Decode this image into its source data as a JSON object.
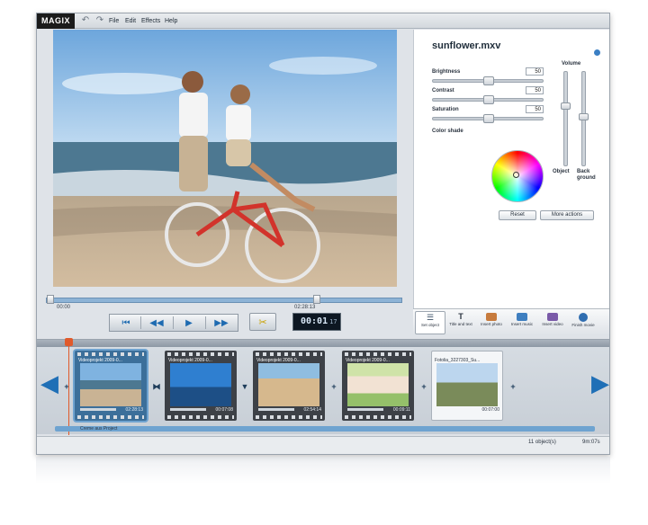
{
  "app": {
    "logo": "MAGIX",
    "menu": [
      "File",
      "Edit",
      "Effects",
      "Help"
    ]
  },
  "right_panel": {
    "filename": "sunflower.mxv",
    "sliders": [
      {
        "label": "Brightness",
        "value": "50",
        "level": 0.5
      },
      {
        "label": "Contrast",
        "value": "50",
        "level": 0.5
      },
      {
        "label": "Saturation",
        "value": "50",
        "level": 0.5
      }
    ],
    "color_shade_label": "Color shade",
    "volume_label": "Volume",
    "object_label": "Object",
    "background_label_1": "Back",
    "background_label_2": "ground",
    "reset_label": "Reset",
    "more_actions_label": "More actions"
  },
  "playback": {
    "start_time": "00:00",
    "end_time": "02:28:13",
    "timecode": "00:01",
    "timecode_frames": "17"
  },
  "toolbar": {
    "items": [
      {
        "label": "Set object",
        "icon": "sliders-icon"
      },
      {
        "label": "Title and text",
        "icon": "text-icon"
      },
      {
        "label": "Insert photo",
        "icon": "photo-icon"
      },
      {
        "label": "Insert music",
        "icon": "music-icon"
      },
      {
        "label": "Insert video",
        "icon": "video-icon"
      },
      {
        "label": "Finish movie",
        "icon": "globe-icon"
      }
    ]
  },
  "storyboard": {
    "clips": [
      {
        "title": "Videoprojekt 2009-0...",
        "time": "02:28:13"
      },
      {
        "title": "Videoprojekt 2009-0...",
        "time": "00:07:08"
      },
      {
        "title": "Videoprojekt 2009-0...",
        "time": "02:54:14"
      },
      {
        "title": "Videoprojekt 2009-0...",
        "time": "00:09:11"
      },
      {
        "title": "Fotolia_3227303_Su...",
        "time": "00:07:00"
      }
    ],
    "footer_label": "Creme aus Project"
  },
  "status": {
    "objects": "11 object(s)",
    "duration": "9m:07s"
  }
}
